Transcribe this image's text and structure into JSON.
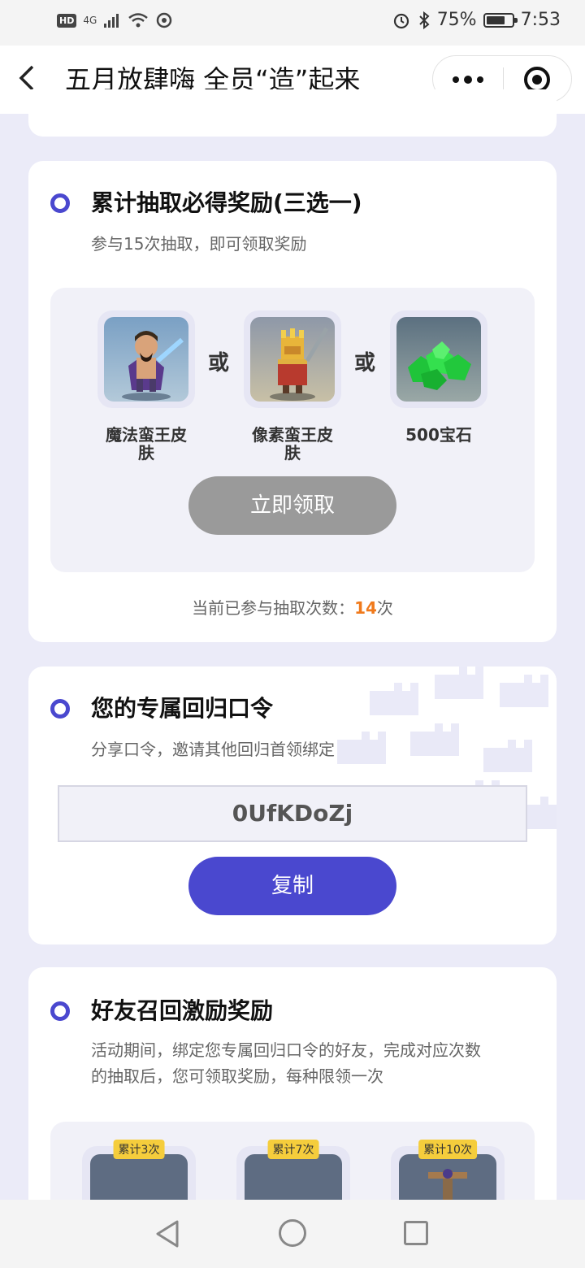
{
  "status_bar": {
    "hd": "HD",
    "network": "4G",
    "battery": "75%",
    "time": "7:53"
  },
  "header": {
    "back_icon": "chevron-left-icon",
    "title": "五月放肆嗨 全员“造”起来"
  },
  "card_draw": {
    "title": "累计抽取必得奖励(三选一)",
    "subtitle": "参与15次抽取，即可领取奖励",
    "or_text": "或",
    "rewards": [
      {
        "label": "魔法蛮王皮\n肤",
        "line1": "魔法蛮王皮",
        "line2": "肤"
      },
      {
        "label": "像素蛮王皮\n肤",
        "line1": "像素蛮王皮",
        "line2": "肤"
      },
      {
        "label": "500宝石",
        "line1": "500宝石",
        "line2": ""
      }
    ],
    "claim_button": "立即领取",
    "count_prefix": "当前已参与抽取次数：",
    "count_value": "14",
    "count_suffix": "次"
  },
  "card_code": {
    "title": "您的专属回归口令",
    "subtitle": "分享口令，邀请其他回归首领绑定",
    "code": "0UfKDoZj",
    "copy_button": "复制"
  },
  "card_friend": {
    "title": "好友召回激励奖励",
    "desc_line1": "活动期间，绑定您专属回归口令的好友，完成对应次数",
    "desc_line2": "的抽取后，您可领取奖励，每种限领一次",
    "tiers": [
      "累计3次",
      "累计7次",
      "累计10次"
    ]
  },
  "colors": {
    "accent": "#4a48cf",
    "highlight": "#f07a1c",
    "disabled": "#9a9a9a",
    "tag": "#f5cd3c"
  }
}
